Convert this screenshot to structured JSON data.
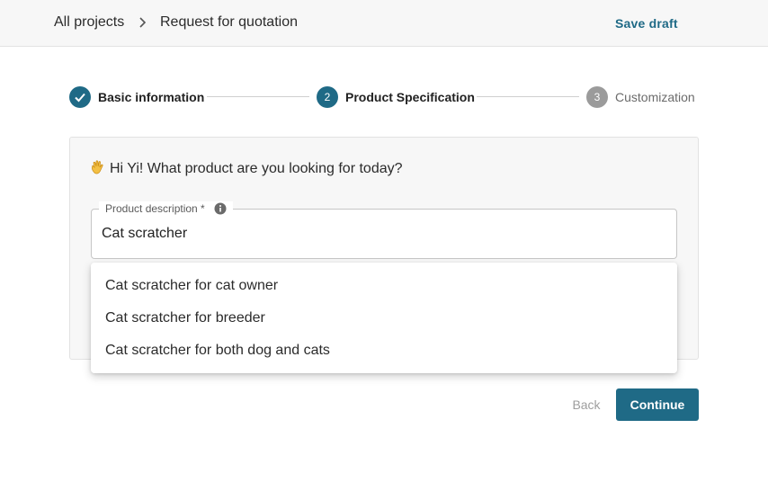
{
  "breadcrumb": {
    "root": "All projects",
    "current": "Request for quotation"
  },
  "header": {
    "save_draft_label": "Save draft"
  },
  "stepper": {
    "steps": [
      {
        "number": "1",
        "label": "Basic information",
        "state": "completed"
      },
      {
        "number": "2",
        "label": "Product Specification",
        "state": "active"
      },
      {
        "number": "3",
        "label": "Customization",
        "state": "pending"
      }
    ]
  },
  "form": {
    "greeting_icon": "waving-hand-icon",
    "greeting": "Hi Yi! What product are you looking for today?",
    "product_description": {
      "label": "Product description *",
      "value": "Cat scratcher",
      "info_icon": "info-icon"
    },
    "suggestions": [
      "Cat scratcher for cat owner",
      "Cat scratcher for breeder",
      "Cat scratcher for both dog and cats"
    ]
  },
  "actions": {
    "back_label": "Back",
    "continue_label": "Continue"
  },
  "colors": {
    "accent": "#1f6a86",
    "pending": "#9b9b9b",
    "card_bg": "#f7f7f7"
  }
}
